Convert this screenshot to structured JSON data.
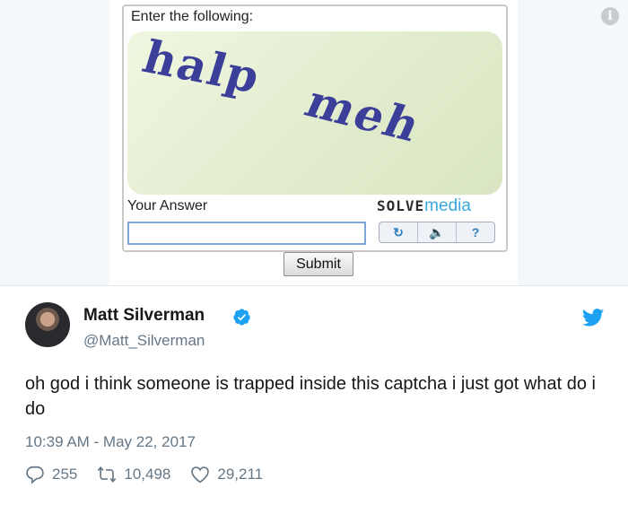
{
  "captcha": {
    "prompt": "Enter the following:",
    "words": [
      "halp",
      "meh"
    ],
    "answer_label": "Your Answer",
    "answer_value": "",
    "brand_solve": "SOLVE",
    "brand_media": "media",
    "controls": [
      {
        "icon": "refresh-icon",
        "glyph": "↻"
      },
      {
        "icon": "audio-icon",
        "glyph": "🔈"
      },
      {
        "icon": "help-icon",
        "glyph": "?"
      }
    ],
    "submit_label": "Submit",
    "info_glyph": "i"
  },
  "tweet": {
    "author_name": "Matt Silverman",
    "author_handle": "@Matt_Silverman",
    "text": "oh god i think someone is trapped inside this captcha i just got what do i do",
    "timestamp": "10:39 AM - May 22, 2017",
    "replies": "255",
    "retweets": "10,498",
    "likes": "29,211",
    "colors": {
      "accent": "#1da1f2",
      "muted": "#657786"
    }
  }
}
